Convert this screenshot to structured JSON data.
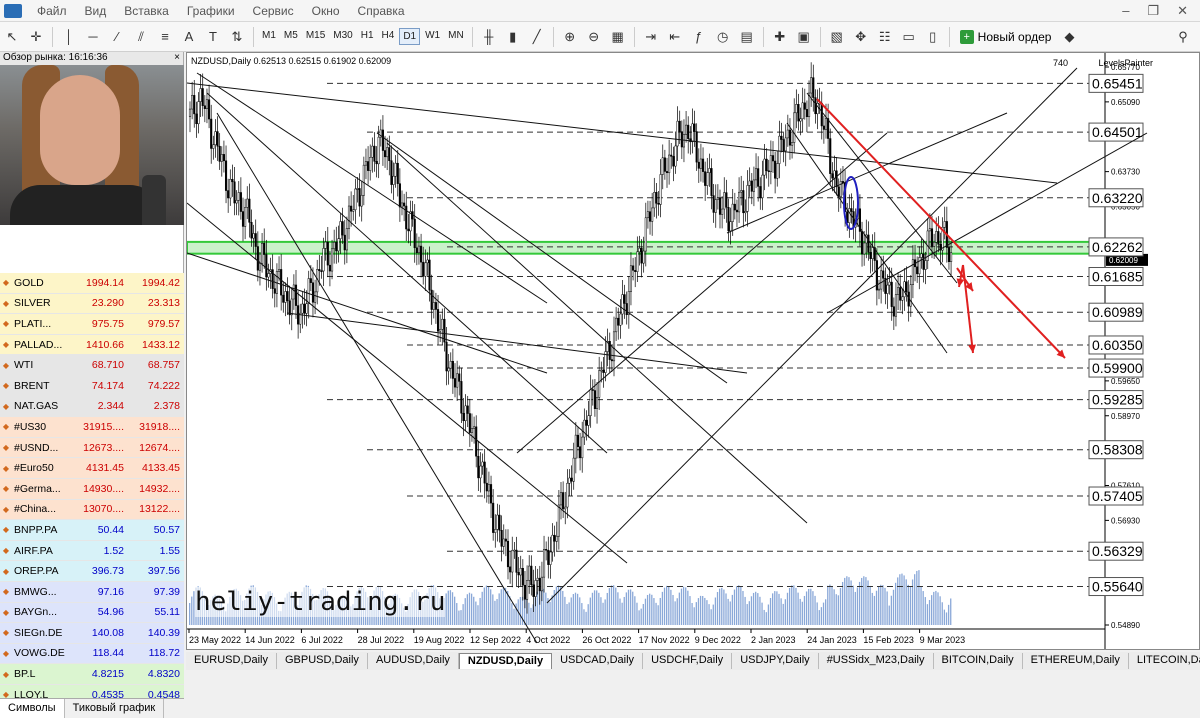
{
  "menu": [
    "Файл",
    "Вид",
    "Вставка",
    "Графики",
    "Сервис",
    "Окно",
    "Справка"
  ],
  "toolbar": {
    "timeframes": [
      "M1",
      "M5",
      "M15",
      "M30",
      "H1",
      "H4",
      "D1",
      "W1",
      "MN"
    ],
    "active_timeframe": "D1",
    "new_order_label": "Новый ордер"
  },
  "market_watch": {
    "title": "Обзор рынка: 16:16:36",
    "rows": [
      {
        "symbol": "GOLD",
        "bid": "1994.14",
        "ask": "1994.42",
        "color": "#fdf5c8",
        "dir": "up"
      },
      {
        "symbol": "SILVER",
        "bid": "23.290",
        "ask": "23.313",
        "color": "#fdf5c8",
        "dir": "up"
      },
      {
        "symbol": "PLATI...",
        "bid": "975.75",
        "ask": "979.57",
        "color": "#fdf5c8",
        "dir": "up"
      },
      {
        "symbol": "PALLAD...",
        "bid": "1410.66",
        "ask": "1433.12",
        "color": "#fdf5c8",
        "dir": "up"
      },
      {
        "symbol": "WTI",
        "bid": "68.710",
        "ask": "68.757",
        "color": "#e6e6e6",
        "dir": "up"
      },
      {
        "symbol": "BRENT",
        "bid": "74.174",
        "ask": "74.222",
        "color": "#e6e6e6",
        "dir": "up"
      },
      {
        "symbol": "NAT.GAS",
        "bid": "2.344",
        "ask": "2.378",
        "color": "#e6e6e6",
        "dir": "up"
      },
      {
        "symbol": "#US30",
        "bid": "31915....",
        "ask": "31918....",
        "color": "#fde2cf",
        "dir": "up"
      },
      {
        "symbol": "#USND...",
        "bid": "12673....",
        "ask": "12674....",
        "color": "#fde2cf",
        "dir": "up"
      },
      {
        "symbol": "#Euro50",
        "bid": "4131.45",
        "ask": "4133.45",
        "color": "#fde2cf",
        "dir": "up"
      },
      {
        "symbol": "#Germa...",
        "bid": "14930....",
        "ask": "14932....",
        "color": "#fde2cf",
        "dir": "up"
      },
      {
        "symbol": "#China...",
        "bid": "13070....",
        "ask": "13122....",
        "color": "#fde2cf",
        "dir": "up"
      },
      {
        "symbol": "BNPP.PA",
        "bid": "50.44",
        "ask": "50.57",
        "color": "#d7f2f8",
        "dir": "up"
      },
      {
        "symbol": "AIRF.PA",
        "bid": "1.52",
        "ask": "1.55",
        "color": "#d7f2f8",
        "dir": "up"
      },
      {
        "symbol": "OREP.PA",
        "bid": "396.73",
        "ask": "397.56",
        "color": "#d7f2f8",
        "dir": "up"
      },
      {
        "symbol": "BMWG...",
        "bid": "97.16",
        "ask": "97.39",
        "color": "#dde4fb",
        "dir": "up"
      },
      {
        "symbol": "BAYGn...",
        "bid": "54.96",
        "ask": "55.11",
        "color": "#dde4fb",
        "dir": "up"
      },
      {
        "symbol": "SIEGn.DE",
        "bid": "140.08",
        "ask": "140.39",
        "color": "#dde4fb",
        "dir": "up"
      },
      {
        "symbol": "VOWG.DE",
        "bid": "118.44",
        "ask": "118.72",
        "color": "#dde4fb",
        "dir": "up"
      },
      {
        "symbol": "BP.L",
        "bid": "4.8215",
        "ask": "4.8320",
        "color": "#dbf5d0",
        "dir": "up"
      },
      {
        "symbol": "LLOY.L",
        "bid": "0.4535",
        "ask": "0.4548",
        "color": "#dbf5d0",
        "dir": "up"
      }
    ],
    "tabs": [
      "Символы",
      "Тиковый график"
    ]
  },
  "chart": {
    "header": "NZDUSD,Daily  0.62513 0.62515 0.61902 0.62009",
    "corner_number": "740",
    "indicator": "LevelsPainter",
    "current_price": "0.62009",
    "watermark": "heliy-trading.ru"
  },
  "chart_data": {
    "type": "candlestick",
    "symbol": "NZDUSD",
    "timeframe": "Daily",
    "ohlc_last": {
      "open": 0.62513,
      "high": 0.62515,
      "low": 0.61902,
      "close": 0.62009
    },
    "price_axis": [
      "0.65770",
      "0.65090",
      "0.64410",
      "0.63730",
      "0.63050",
      "0.62370",
      "0.61690",
      "0.61010",
      "0.60330",
      "0.59650",
      "0.58970",
      "0.58290",
      "0.57610",
      "0.56930",
      "0.56250",
      "0.55570",
      "0.54890"
    ],
    "ylim": [
      0.5489,
      0.6577
    ],
    "date_axis": [
      "23 May 2022",
      "14 Jun 2022",
      "6 Jul 2022",
      "28 Jul 2022",
      "19 Aug 2022",
      "12 Sep 2022",
      "4 Oct 2022",
      "26 Oct 2022",
      "17 Nov 2022",
      "9 Dec 2022",
      "2 Jan 2023",
      "24 Jan 2023",
      "15 Feb 2023",
      "9 Mar 2023"
    ],
    "levels": [
      "0.65451",
      "0.64501",
      "0.63220",
      "0.62262",
      "0.61685",
      "0.60989",
      "0.60350",
      "0.59900",
      "0.59285",
      "0.58308",
      "0.57405",
      "0.56329",
      "0.55640"
    ],
    "path_closes": [
      0.648,
      0.652,
      0.645,
      0.638,
      0.632,
      0.63,
      0.622,
      0.618,
      0.615,
      0.612,
      0.61,
      0.614,
      0.62,
      0.622,
      0.626,
      0.632,
      0.638,
      0.643,
      0.64,
      0.632,
      0.626,
      0.62,
      0.612,
      0.603,
      0.596,
      0.59,
      0.582,
      0.574,
      0.566,
      0.562,
      0.558,
      0.556,
      0.56,
      0.567,
      0.575,
      0.583,
      0.59,
      0.597,
      0.603,
      0.61,
      0.617,
      0.624,
      0.632,
      0.638,
      0.643,
      0.646,
      0.64,
      0.634,
      0.63,
      0.629,
      0.632,
      0.635,
      0.637,
      0.64,
      0.644,
      0.648,
      0.652,
      0.65,
      0.638,
      0.632,
      0.628,
      0.624,
      0.618,
      0.614,
      0.612,
      0.615,
      0.62,
      0.624,
      0.625,
      0.62
    ],
    "current_price": 0.62009
  },
  "symbol_tabs": [
    "EURUSD,Daily",
    "GBPUSD,Daily",
    "AUDUSD,Daily",
    "NZDUSD,Daily",
    "USDCAD,Daily",
    "USDCHF,Daily",
    "USDJPY,Daily",
    "#USSidx_M23,Daily",
    "BITCOIN,Daily",
    "ETHEREUM,Daily",
    "LITECOIN,Daily"
  ],
  "active_symbol_tab": "NZDUSD,Daily",
  "colors": {
    "level_box_border": "#555555",
    "green_zone": "#34c93a",
    "red_arrow": "#e02020",
    "candle": "#000000",
    "volume": "#8aa8d8"
  }
}
